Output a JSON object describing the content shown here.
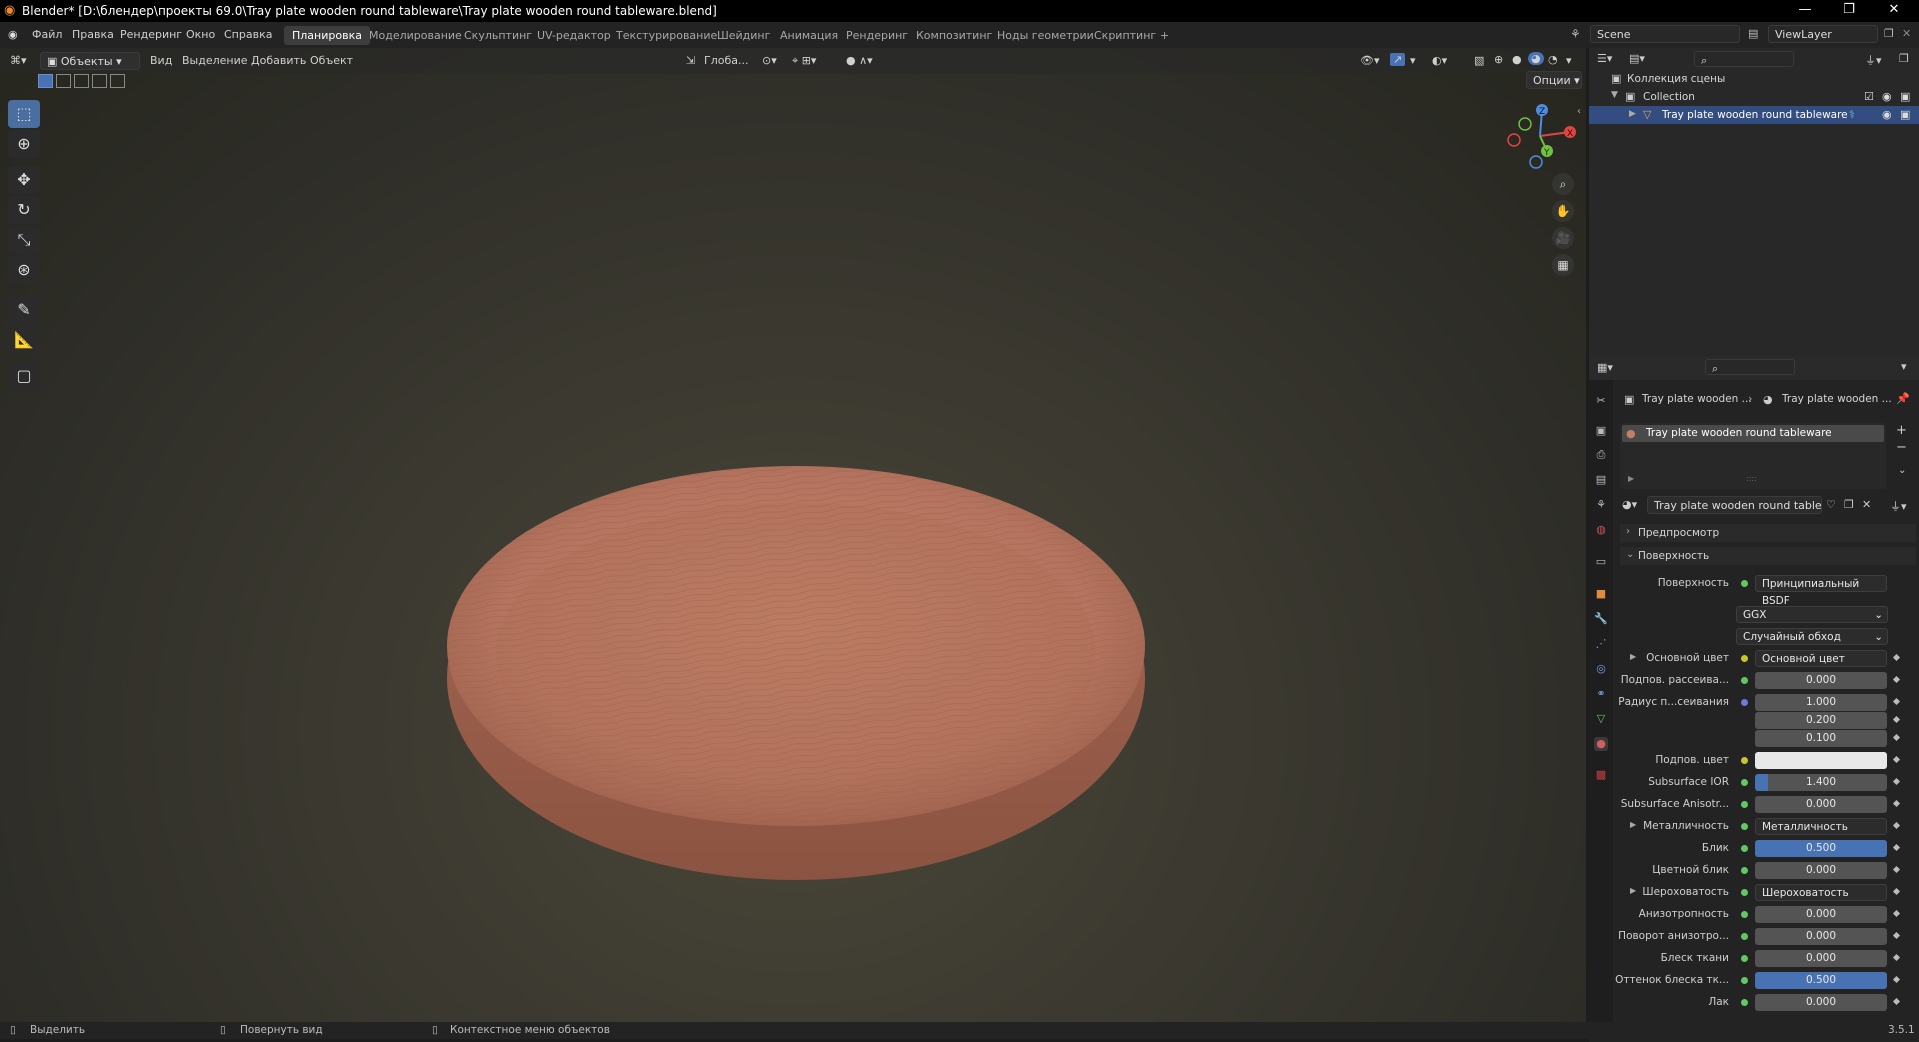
{
  "title": "Blender* [D:\\блендер\\проекты 69.0\\Tray plate wooden round tableware\\Tray plate wooden round tableware.blend]",
  "menu": [
    "Файл",
    "Правка",
    "Рендеринг",
    "Окно",
    "Справка"
  ],
  "workspaces": [
    "Планировка",
    "Моделирование",
    "Скульптинг",
    "UV-редактор",
    "Текстурирование",
    "Шейдинг",
    "Анимация",
    "Рендеринг",
    "Композитинг",
    "Ноды геометрии",
    "Скриптинг"
  ],
  "scene": "Scene",
  "viewlayer": "ViewLayer",
  "viewport": {
    "mode": "Объекты",
    "menu": [
      "Вид",
      "Выделение",
      "Добавить",
      "Объект"
    ],
    "orientation": "Глоба...",
    "options": "Опции",
    "gizmo_axes": [
      "X",
      "Y",
      "Z"
    ]
  },
  "outliner": {
    "root": "Коллекция сцены",
    "collection": "Collection",
    "object": "Tray plate wooden round tableware"
  },
  "properties": {
    "breadcrumb_1": "Tray plate wooden ...",
    "breadcrumb_2": "Tray plate wooden ...",
    "slot": "Tray plate wooden round tableware",
    "material": "Tray plate wooden round tableware",
    "section_preview": "Предпросмотр",
    "section_surface": "Поверхность",
    "surface_label": "Поверхность",
    "surface_value": "Принципиальный BSDF",
    "distribution": "GGX",
    "subsurface_method": "Случайный обход",
    "rows": [
      {
        "label": "Основной цвет",
        "value": "Основной цвет",
        "kind": "link",
        "dot": "y"
      },
      {
        "label": "Подпов. рассеива...",
        "value": "0.000",
        "kind": "num",
        "dot": "g"
      },
      {
        "label": "Радиус п...сеивания",
        "value": "1.000",
        "kind": "num",
        "dot": "b"
      },
      {
        "label": "",
        "value": "0.200",
        "kind": "num",
        "dot": ""
      },
      {
        "label": "",
        "value": "0.100",
        "kind": "num",
        "dot": ""
      },
      {
        "label": "Подпов. цвет",
        "value": "",
        "kind": "color",
        "dot": "y"
      },
      {
        "label": "Subsurface IOR",
        "value": "1.400",
        "kind": "num",
        "dot": "g",
        "fill": 0.1
      },
      {
        "label": "Subsurface Anisotr...",
        "value": "0.000",
        "kind": "num",
        "dot": "g"
      },
      {
        "label": "Металличность",
        "value": "Металличность",
        "kind": "link",
        "dot": "g"
      },
      {
        "label": "Блик",
        "value": "0.500",
        "kind": "num",
        "dot": "g",
        "fill": 1
      },
      {
        "label": "Цветной блик",
        "value": "0.000",
        "kind": "num",
        "dot": "g"
      },
      {
        "label": "Шероховатость",
        "value": "Шероховатость",
        "kind": "link",
        "dot": "g"
      },
      {
        "label": "Анизотропность",
        "value": "0.000",
        "kind": "num",
        "dot": "g"
      },
      {
        "label": "Поворот анизотро...",
        "value": "0.000",
        "kind": "num",
        "dot": "g"
      },
      {
        "label": "Блеск ткани",
        "value": "0.000",
        "kind": "num",
        "dot": "g"
      },
      {
        "label": "Оттенок блеска тк...",
        "value": "0.500",
        "kind": "num",
        "dot": "g",
        "fill": 1
      },
      {
        "label": "Лак",
        "value": "0.000",
        "kind": "num",
        "dot": "g"
      }
    ]
  },
  "status": {
    "select": "Выделить",
    "rotate": "Повернуть вид",
    "context": "Контекстное меню объектов",
    "version": "3.5.1"
  },
  "colors": {
    "accent": "#4772b3",
    "plate": "#b3735e"
  }
}
